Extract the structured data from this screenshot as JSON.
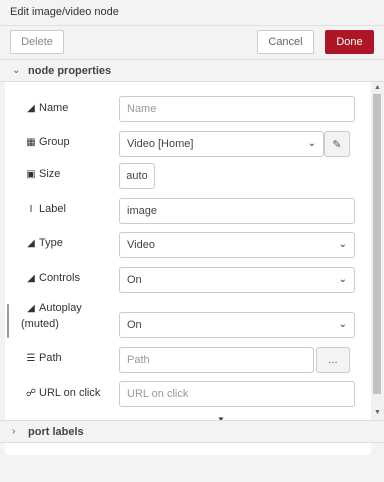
{
  "window": {
    "title": "Edit image/video node"
  },
  "toolbar": {
    "delete_label": "Delete",
    "cancel_label": "Cancel",
    "done_label": "Done"
  },
  "sections": {
    "props_label": "node properties",
    "ports_label": "port labels"
  },
  "fields": {
    "name": {
      "label": "Name",
      "placeholder": "Name",
      "value": ""
    },
    "group": {
      "label": "Group",
      "value": "Video [Home]"
    },
    "size": {
      "label": "Size",
      "value": "auto"
    },
    "label": {
      "label": "Label",
      "value": "image"
    },
    "type": {
      "label": "Type",
      "value": "Video"
    },
    "controls": {
      "label": "Controls",
      "value": "On"
    },
    "autoplay": {
      "label_line1": "Autoplay",
      "label_line2": "(muted)",
      "value": "On"
    },
    "path": {
      "label": "Path",
      "placeholder": "Path",
      "browse_label": "..."
    },
    "url": {
      "label": "URL on click",
      "placeholder": "URL on click"
    }
  },
  "icons": {
    "tag": "tag-icon",
    "table": "table-icon",
    "resize": "resize-icon",
    "text_cursor": "text-cursor-icon",
    "list": "list-icon",
    "link": "link-icon",
    "pencil": "pencil-icon",
    "chevron_down": "chevron-down-icon",
    "chevron_right": "chevron-right-icon",
    "caret_down": "caret-down-icon"
  },
  "colors": {
    "done_button": "#ad1625",
    "background": "#f3f3f3",
    "panel": "#ffffff"
  }
}
